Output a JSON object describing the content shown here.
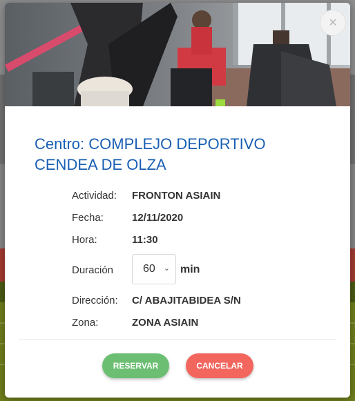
{
  "modal": {
    "close_label": "×",
    "title": "Centro: COMPLEJO DEPORTIVO CENDEA DE OLZA",
    "details": {
      "actividad_label": "Actividad:",
      "actividad_value": "FRONTON ASIAIN",
      "fecha_label": "Fecha:",
      "fecha_value": "12/11/2020",
      "hora_label": "Hora:",
      "hora_value": "11:30",
      "duracion_label": "Duración",
      "duracion_value": "60",
      "duracion_unit": "min",
      "direccion_label": "Dirección:",
      "direccion_value": "C/ ABAJITABIDEA S/N",
      "zona_label": "Zona:",
      "zona_value": "ZONA ASIAIN"
    },
    "buttons": {
      "reserve_label": "RESERVAR",
      "cancel_label": "CANCELAR"
    }
  },
  "colors": {
    "title": "#1a5fb4",
    "reserve": "#6cbf72",
    "cancel": "#f2665e"
  },
  "icons": {
    "close": "close-icon",
    "select_chevron": "chevron-down-icon"
  }
}
